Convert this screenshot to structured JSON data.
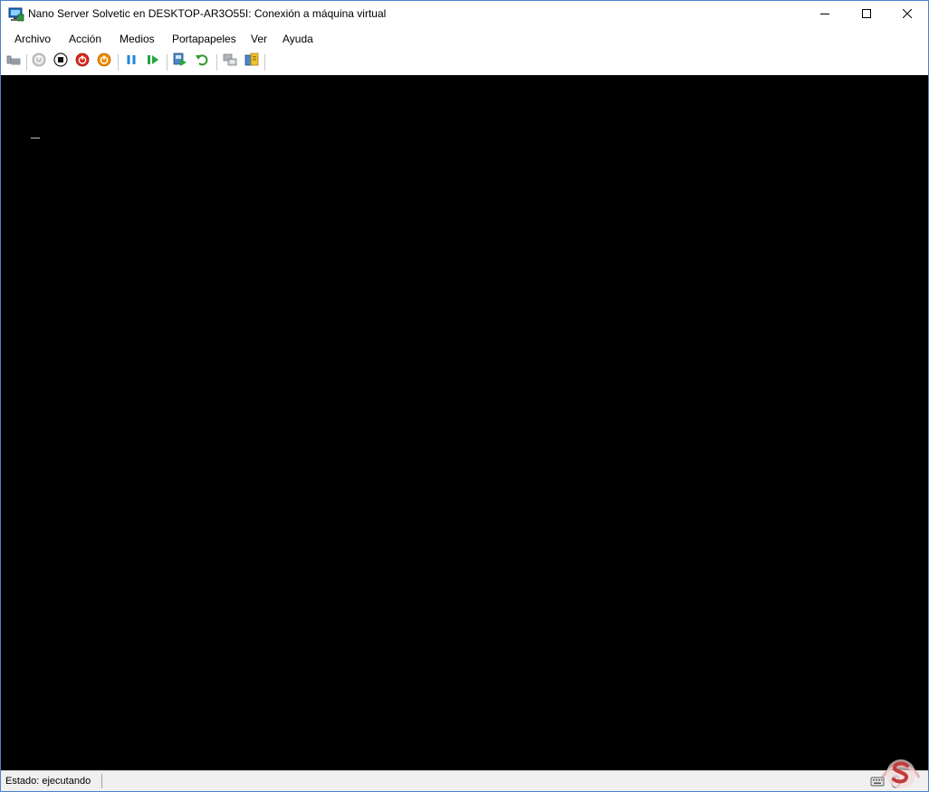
{
  "window": {
    "title": "Nano Server Solvetic en DESKTOP-AR3O55I: Conexión a máquina virtual",
    "app_icon": "vm-connect-icon",
    "controls": [
      "minimize-icon",
      "maximize-icon",
      "close-icon"
    ]
  },
  "menu": {
    "items": [
      "Archivo",
      "Acción",
      "Medios",
      "Portapapeles",
      "Ver",
      "Ayuda"
    ]
  },
  "toolbar": {
    "buttons": [
      "ctrl-alt-del-icon",
      "start-icon",
      "turn-off-icon",
      "shutdown-icon",
      "save-icon",
      "pause-icon",
      "resume-icon",
      "checkpoint-icon",
      "revert-icon",
      "enhanced-session-icon",
      "share-icon"
    ]
  },
  "vm_screen": {
    "background": "#000000",
    "cursor_char": "_"
  },
  "status": {
    "text": "Estado: ejecutando",
    "icons": [
      "keyboard-icon",
      "mouse-icon"
    ]
  },
  "colors": {
    "accent_border": "#4a84c9",
    "stop_red": "#d9261c",
    "save_orange": "#f08c00",
    "pause_blue": "#1f87d6",
    "resume_green": "#22a93a",
    "revert_green": "#2e9a2e"
  }
}
